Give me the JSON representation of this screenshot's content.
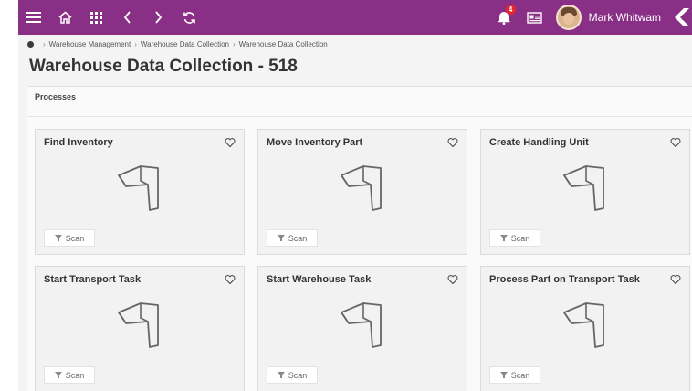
{
  "user": {
    "name": "Mark Whitwam"
  },
  "notifications": {
    "count": "4"
  },
  "breadcrumb": [
    "Warehouse Management",
    "Warehouse Data Collection",
    "Warehouse Data Collection"
  ],
  "page": {
    "title": "Warehouse Data Collection - 518"
  },
  "processes": {
    "header": "Processes",
    "cards": [
      {
        "title": "Find Inventory",
        "scan_label": "Scan"
      },
      {
        "title": "Move Inventory Part",
        "scan_label": "Scan"
      },
      {
        "title": "Create Handling Unit",
        "scan_label": "Scan"
      },
      {
        "title": "Start Transport Task",
        "scan_label": "Scan"
      },
      {
        "title": "Start Warehouse Task",
        "scan_label": "Scan"
      },
      {
        "title": "Process Part on Transport Task",
        "scan_label": "Scan"
      }
    ]
  },
  "icons": {
    "menu": "menu-icon",
    "home": "home-icon",
    "apps": "apps-grid-icon",
    "back": "chevron-left-icon",
    "forward": "chevron-right-icon",
    "refresh": "refresh-icon",
    "bell": "bell-icon",
    "card": "id-card-icon",
    "favorite": "heart-icon",
    "scanner": "barcode-scanner-icon",
    "scan": "scan-funnel-icon"
  },
  "colors": {
    "topbar": "#8a2f86",
    "badge": "#e3262b"
  }
}
